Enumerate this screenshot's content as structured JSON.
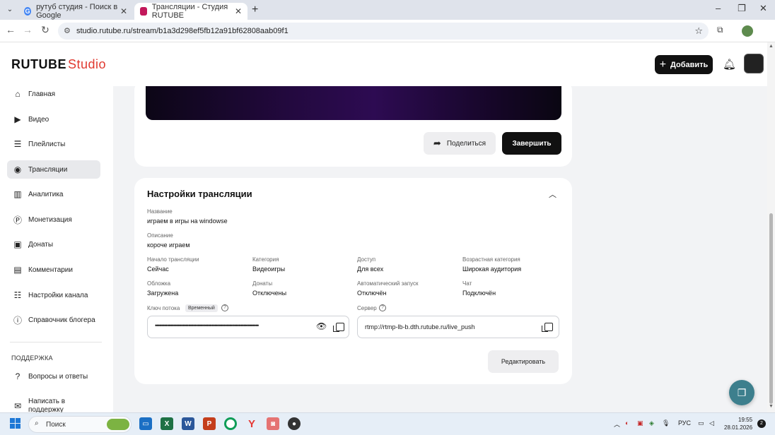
{
  "browser": {
    "tabs": [
      {
        "title": "рутуб студия - Поиск в Google"
      },
      {
        "title": "Трансляции - Студия RUTUBE"
      }
    ],
    "url": "studio.rutube.ru/stream/b1a3d298ef5fb12a91bf62808aab09f1"
  },
  "header": {
    "logo_main": "RUTUBE",
    "logo_suffix": "Studio",
    "add_label": "Добавить"
  },
  "sidebar": {
    "items": [
      {
        "label": "Главная",
        "icon": "home-icon"
      },
      {
        "label": "Видео",
        "icon": "video-icon"
      },
      {
        "label": "Плейлисты",
        "icon": "playlist-icon"
      },
      {
        "label": "Трансляции",
        "icon": "broadcast-icon",
        "active": true
      },
      {
        "label": "Аналитика",
        "icon": "analytics-icon"
      },
      {
        "label": "Монетизация",
        "icon": "monetization-icon"
      },
      {
        "label": "Донаты",
        "icon": "donate-icon"
      },
      {
        "label": "Комментарии",
        "icon": "comments-icon"
      },
      {
        "label": "Настройки канала",
        "icon": "settings-icon"
      },
      {
        "label": "Справочник блогера",
        "icon": "handbook-icon"
      }
    ],
    "support_heading": "ПОДДЕРЖКА",
    "support_items": [
      {
        "label": "Вопросы и ответы",
        "icon": "faq-icon"
      },
      {
        "label": "Написать в поддержку",
        "icon": "mail-icon"
      }
    ]
  },
  "player": {
    "share_label": "Поделиться",
    "finish_label": "Завершить"
  },
  "settings": {
    "title": "Настройки трансляции",
    "name_label": "Название",
    "name_value": "играем в игры на windowse",
    "desc_label": "Описание",
    "desc_value": "короче играем",
    "start_label": "Начало трансляции",
    "start_value": "Сейчас",
    "category_label": "Категория",
    "category_value": "Видеоигры",
    "access_label": "Доступ",
    "access_value": "Для всех",
    "age_label": "Возрастная категория",
    "age_value": "Широкая аудитория",
    "cover_label": "Обложка",
    "cover_value": "Загружена",
    "donates_label": "Донаты",
    "donates_value": "Отключены",
    "autostart_label": "Автоматический запуск",
    "autostart_value": "Отключён",
    "chat_label": "Чат",
    "chat_value": "Подключён",
    "key_label": "Ключ потока",
    "key_badge": "Временный",
    "key_masked": "••••••••••••••••••••••••••••••••••••••••••••••••••••••••••••••••••••",
    "server_label": "Сервер",
    "server_value": "rtmp://rtmp-lb-b.dth.rutube.ru/live_push",
    "edit_label": "Редактировать"
  },
  "taskbar": {
    "search_label": "Поиск",
    "lang": "РУС",
    "time": "19:55",
    "date": "28.01.2026",
    "notifications": "2"
  },
  "colors": {
    "accent_red": "#e03a30",
    "button_dark": "#111111",
    "help_fab": "#3d7f8d"
  }
}
